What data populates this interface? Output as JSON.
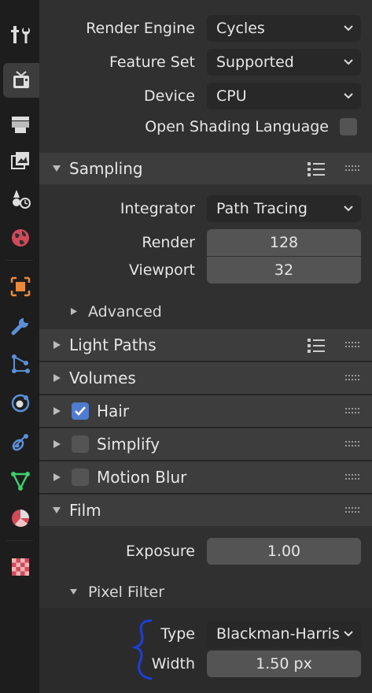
{
  "render": {
    "engine_label": "Render Engine",
    "engine_value": "Cycles",
    "feature_set_label": "Feature Set",
    "feature_set_value": "Supported",
    "device_label": "Device",
    "device_value": "CPU",
    "osl_label": "Open Shading Language",
    "osl_checked": false
  },
  "sampling": {
    "title": "Sampling",
    "integrator_label": "Integrator",
    "integrator_value": "Path Tracing",
    "render_label": "Render",
    "render_value": "128",
    "viewport_label": "Viewport",
    "viewport_value": "32",
    "advanced_label": "Advanced"
  },
  "panels": {
    "light_paths": "Light Paths",
    "volumes": "Volumes",
    "hair": "Hair",
    "hair_checked": true,
    "simplify": "Simplify",
    "simplify_checked": false,
    "motion_blur": "Motion Blur",
    "motion_blur_checked": false
  },
  "film": {
    "title": "Film",
    "exposure_label": "Exposure",
    "exposure_value": "1.00",
    "pixel_filter_label": "Pixel Filter",
    "type_label": "Type",
    "type_value": "Blackman-Harris",
    "width_label": "Width",
    "width_value": "1.50 px"
  },
  "tabs": [
    {
      "icon": "tool-icon"
    },
    {
      "icon": "render-icon",
      "active": true
    },
    {
      "icon": "output-icon"
    },
    {
      "icon": "view-layer-icon"
    },
    {
      "icon": "scene-icon"
    },
    {
      "icon": "world-icon"
    },
    {
      "icon": "object-icon"
    },
    {
      "icon": "modifier-icon"
    },
    {
      "icon": "particles-icon"
    },
    {
      "icon": "physics-icon"
    },
    {
      "icon": "constraints-icon"
    },
    {
      "icon": "data-icon"
    },
    {
      "icon": "material-icon"
    },
    {
      "icon": "texture-icon"
    }
  ],
  "colors": {
    "accent_blue": "#4f7bd0",
    "annotation_brace": "#1f3dd8",
    "object_orange": "#e88a3c",
    "world_red": "#d04a5a",
    "modifier_blue": "#5b8fd6",
    "data_green": "#3ecf6e"
  }
}
